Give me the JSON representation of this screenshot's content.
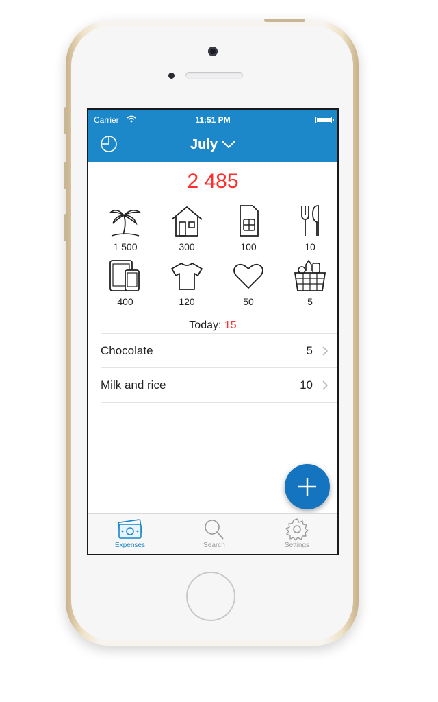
{
  "status_bar": {
    "carrier": "Carrier",
    "time": "11:51 PM"
  },
  "header": {
    "month": "July",
    "accent_color": "#1c87c9"
  },
  "summary": {
    "total": "2 485",
    "total_color": "#ff2d2d"
  },
  "categories": [
    {
      "icon": "palm-tree-icon",
      "value": "1 500"
    },
    {
      "icon": "house-icon",
      "value": "300"
    },
    {
      "icon": "sim-card-icon",
      "value": "100"
    },
    {
      "icon": "fork-knife-icon",
      "value": "10"
    },
    {
      "icon": "tablet-phone-icon",
      "value": "400"
    },
    {
      "icon": "t-shirt-icon",
      "value": "120"
    },
    {
      "icon": "heart-icon",
      "value": "50"
    },
    {
      "icon": "grocery-basket-icon",
      "value": "5"
    }
  ],
  "today": {
    "label": "Today:",
    "value": "15"
  },
  "expenses": [
    {
      "name": "Chocolate",
      "amount": "5"
    },
    {
      "name": "Milk and rice",
      "amount": "10"
    }
  ],
  "fab": {
    "icon": "plus-icon"
  },
  "tabs": [
    {
      "label": "Expenses",
      "icon": "money-icon",
      "active": true
    },
    {
      "label": "Search",
      "icon": "search-icon",
      "active": false
    },
    {
      "label": "Settings",
      "icon": "gear-icon",
      "active": false
    }
  ]
}
